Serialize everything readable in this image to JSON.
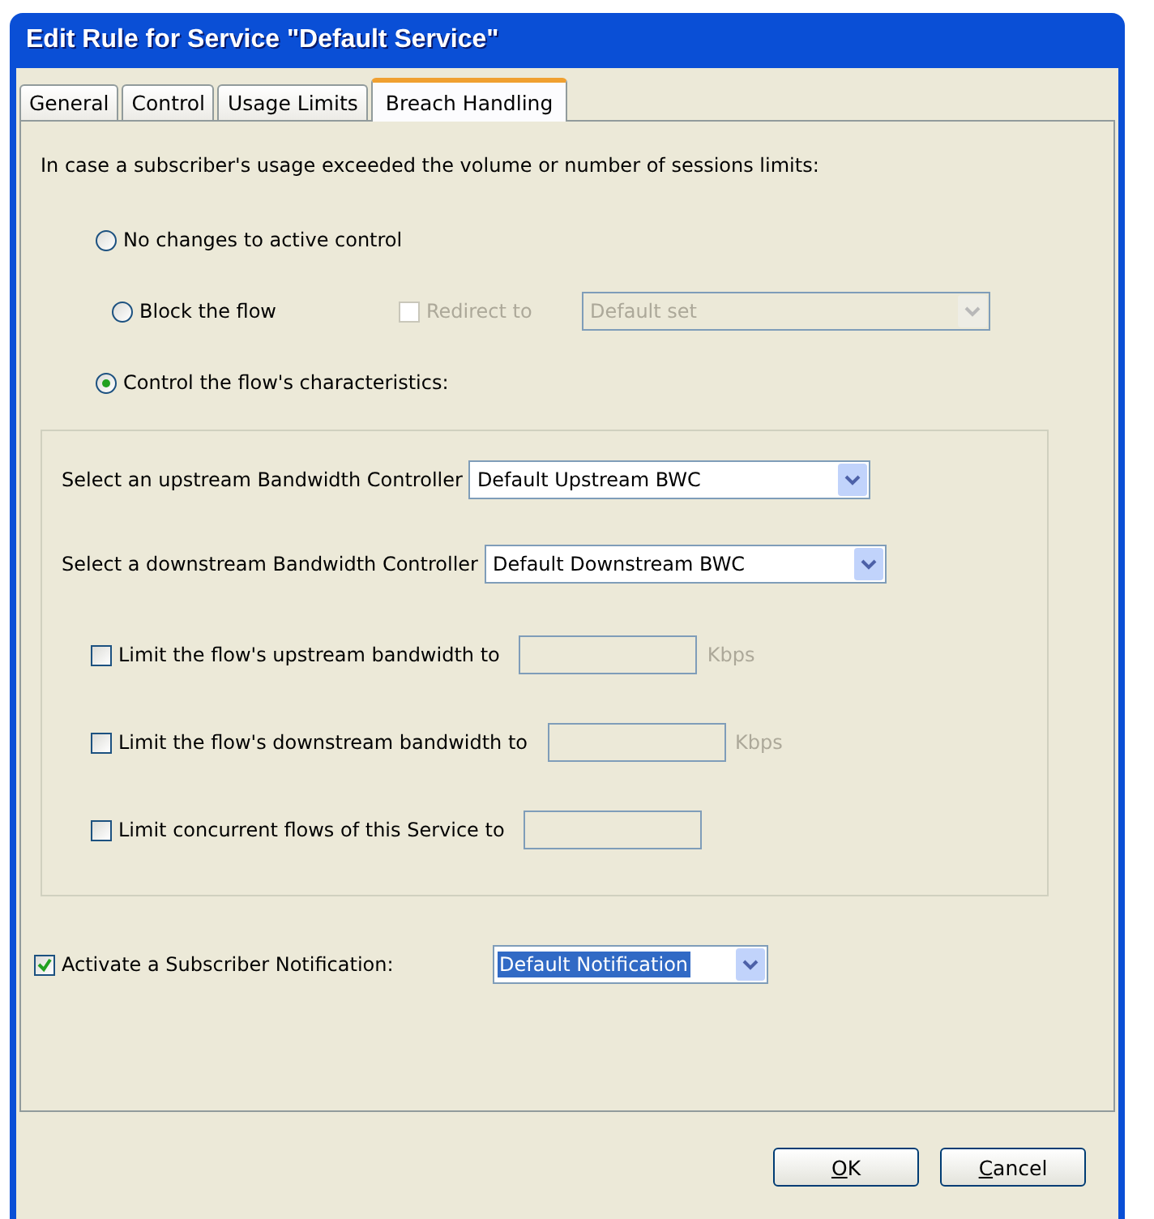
{
  "window": {
    "title": "Edit Rule for Service \"Default Service\""
  },
  "tabs": [
    {
      "label": "General",
      "selected": false
    },
    {
      "label": "Control",
      "selected": false
    },
    {
      "label": "Usage Limits",
      "selected": false
    },
    {
      "label": "Breach Handling",
      "selected": true
    }
  ],
  "intro": "In case a subscriber's usage exceeded the volume or number of sessions limits:",
  "options": [
    {
      "label": "No changes to active control",
      "selected": false
    },
    {
      "label": "Block the flow",
      "selected": false,
      "redirect": {
        "label": "Redirect to",
        "checked": false,
        "disabled": true,
        "value": "Default set"
      }
    },
    {
      "label": "Control the flow's characteristics:",
      "selected": true
    }
  ],
  "controllers": [
    {
      "label": "Select an upstream Bandwidth Controller",
      "value": "Default Upstream BWC"
    },
    {
      "label": "Select a downstream Bandwidth Controller",
      "value": "Default Downstream BWC"
    }
  ],
  "limits": [
    {
      "label": "Limit the flow's upstream bandwidth to",
      "checked": false,
      "unit": "Kbps"
    },
    {
      "label": "Limit the flow's downstream bandwidth to",
      "checked": false,
      "unit": "Kbps"
    },
    {
      "label": "Limit concurrent flows of this Service to",
      "checked": false
    }
  ],
  "notification": {
    "label": "Activate a Subscriber Notification:",
    "checked": true,
    "value": "Default Notification",
    "highlighted": true
  },
  "buttons": [
    {
      "label": "OK"
    },
    {
      "label": "Cancel"
    }
  ]
}
